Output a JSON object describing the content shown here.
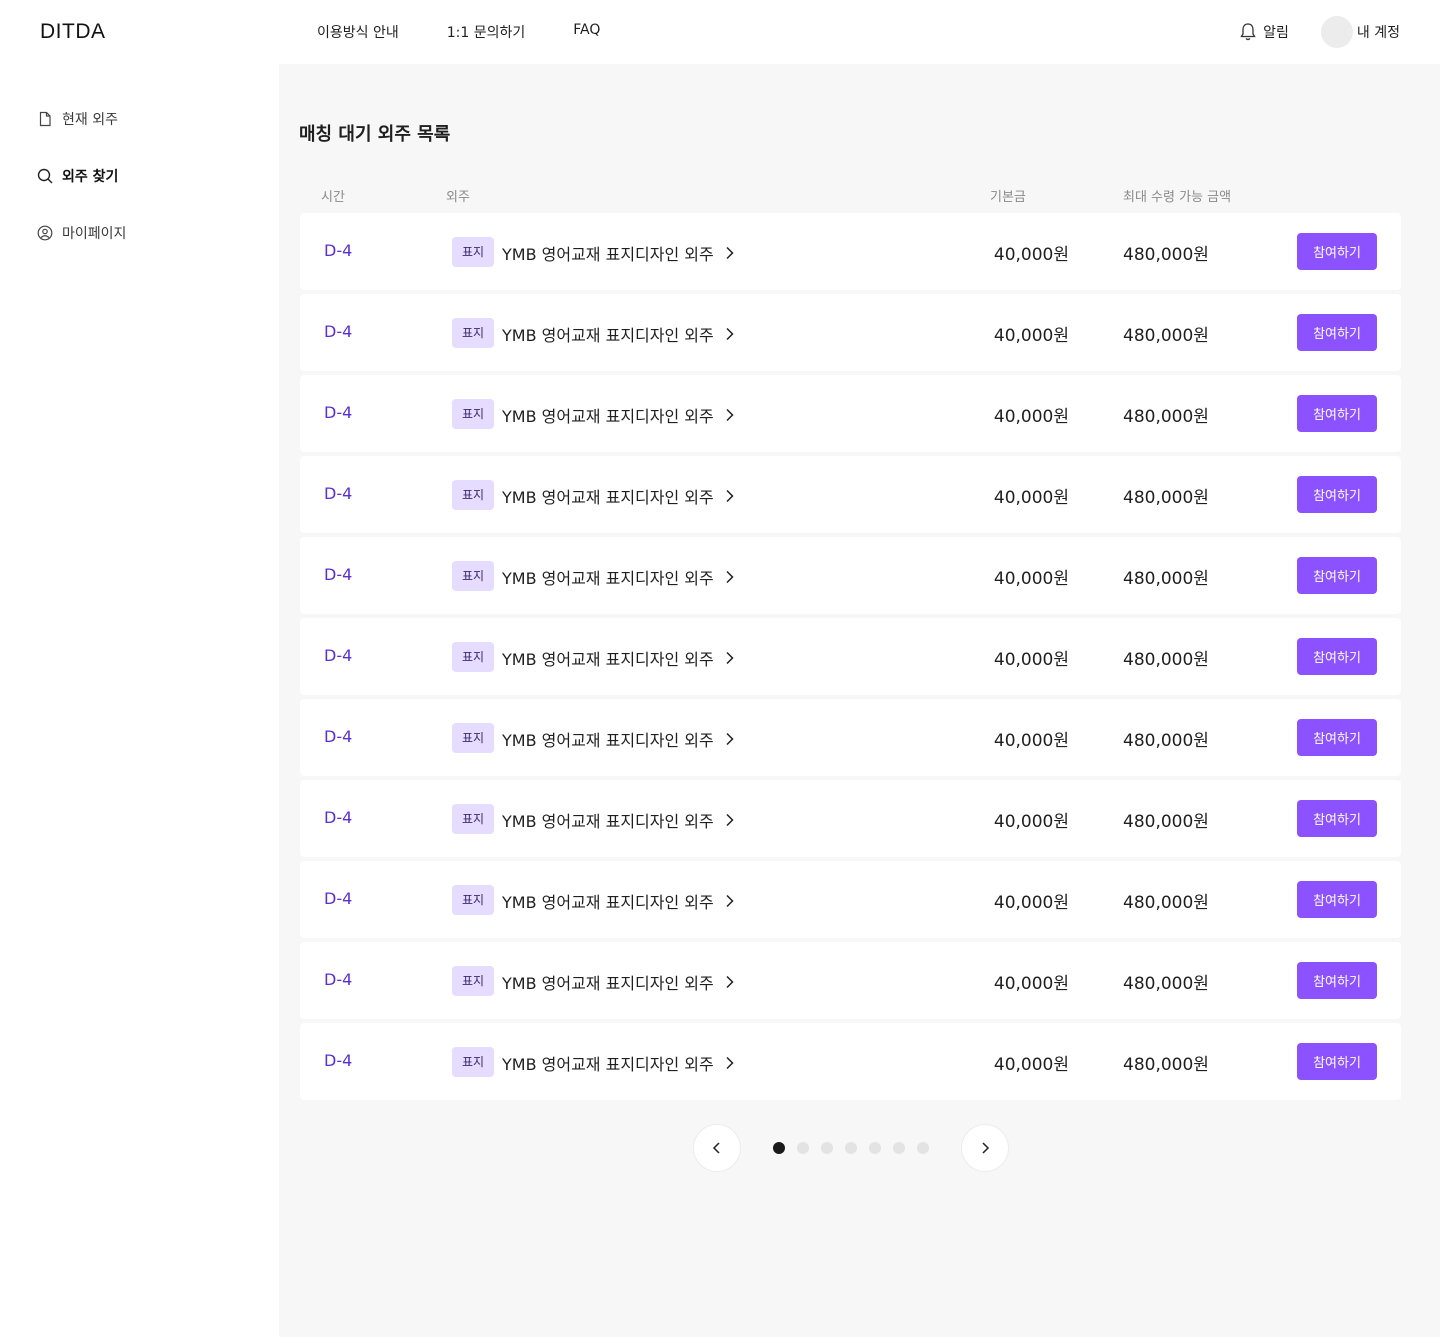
{
  "brand": {
    "logo": "DITDA"
  },
  "topnav": {
    "items": [
      "이용방식 안내",
      "1:1 문의하기",
      "FAQ"
    ]
  },
  "header": {
    "notification_label": "알림",
    "account_label": "내 계정"
  },
  "sidebar": {
    "items": [
      {
        "label": "현재 외주",
        "icon": "document-icon"
      },
      {
        "label": "외주 찾기",
        "icon": "search-icon",
        "active": true
      },
      {
        "label": "마이페이지",
        "icon": "user-circle-icon"
      }
    ]
  },
  "main": {
    "title": "매칭 대기 외주 목록",
    "columns": {
      "time": "시간",
      "job": "외주",
      "base_pay": "기본금",
      "max_pay": "최대 수령 가능 금액"
    }
  },
  "rows": [
    {
      "dday": "D-4",
      "tag": "표지",
      "title": "YMB 영어교재 표지디자인 외주",
      "base_pay": "40,000원",
      "max_pay": "480,000원",
      "button": "참여하기"
    },
    {
      "dday": "D-4",
      "tag": "표지",
      "title": "YMB 영어교재 표지디자인 외주",
      "base_pay": "40,000원",
      "max_pay": "480,000원",
      "button": "참여하기"
    },
    {
      "dday": "D-4",
      "tag": "표지",
      "title": "YMB 영어교재 표지디자인 외주",
      "base_pay": "40,000원",
      "max_pay": "480,000원",
      "button": "참여하기"
    },
    {
      "dday": "D-4",
      "tag": "표지",
      "title": "YMB 영어교재 표지디자인 외주",
      "base_pay": "40,000원",
      "max_pay": "480,000원",
      "button": "참여하기"
    },
    {
      "dday": "D-4",
      "tag": "표지",
      "title": "YMB 영어교재 표지디자인 외주",
      "base_pay": "40,000원",
      "max_pay": "480,000원",
      "button": "참여하기"
    },
    {
      "dday": "D-4",
      "tag": "표지",
      "title": "YMB 영어교재 표지디자인 외주",
      "base_pay": "40,000원",
      "max_pay": "480,000원",
      "button": "참여하기"
    },
    {
      "dday": "D-4",
      "tag": "표지",
      "title": "YMB 영어교재 표지디자인 외주",
      "base_pay": "40,000원",
      "max_pay": "480,000원",
      "button": "참여하기"
    },
    {
      "dday": "D-4",
      "tag": "표지",
      "title": "YMB 영어교재 표지디자인 외주",
      "base_pay": "40,000원",
      "max_pay": "480,000원",
      "button": "참여하기"
    },
    {
      "dday": "D-4",
      "tag": "표지",
      "title": "YMB 영어교재 표지디자인 외주",
      "base_pay": "40,000원",
      "max_pay": "480,000원",
      "button": "참여하기"
    },
    {
      "dday": "D-4",
      "tag": "표지",
      "title": "YMB 영어교재 표지디자인 외주",
      "base_pay": "40,000원",
      "max_pay": "480,000원",
      "button": "참여하기"
    },
    {
      "dday": "D-4",
      "tag": "표지",
      "title": "YMB 영어교재 표지디자인 외주",
      "base_pay": "40,000원",
      "max_pay": "480,000원",
      "button": "참여하기"
    }
  ],
  "pagination": {
    "page_count": 7,
    "current_page": 1
  },
  "colors": {
    "accent": "#8c52ff",
    "dday": "#5a2fd6",
    "tag_bg": "#e6dcff",
    "main_bg": "#f7f7f7"
  }
}
